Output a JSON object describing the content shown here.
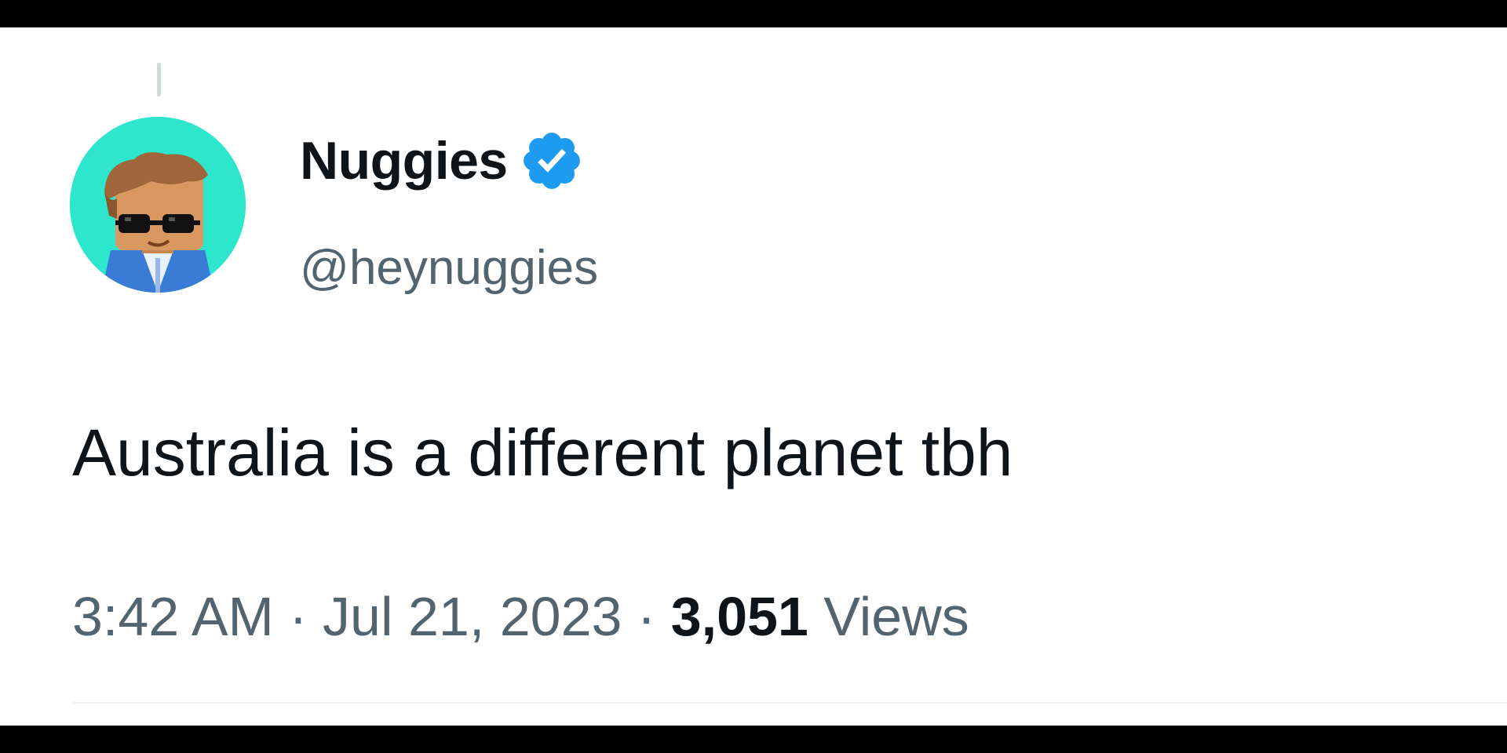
{
  "tweet": {
    "author": {
      "display_name": "Nuggies",
      "handle": "@heynuggies",
      "verified": true,
      "avatar_icon": "cartoon-avatar-sunglasses",
      "avatar_bg": "#2ee6cc"
    },
    "text": "Australia is a different planet tbh",
    "time": "3:42 AM",
    "separator": "·",
    "date": "Jul 21, 2023",
    "views_count": "3,051",
    "views_label": "Views"
  },
  "colors": {
    "verified_badge": "#1d9bf0",
    "primary_text": "#0f1419",
    "secondary_text": "#536471"
  }
}
